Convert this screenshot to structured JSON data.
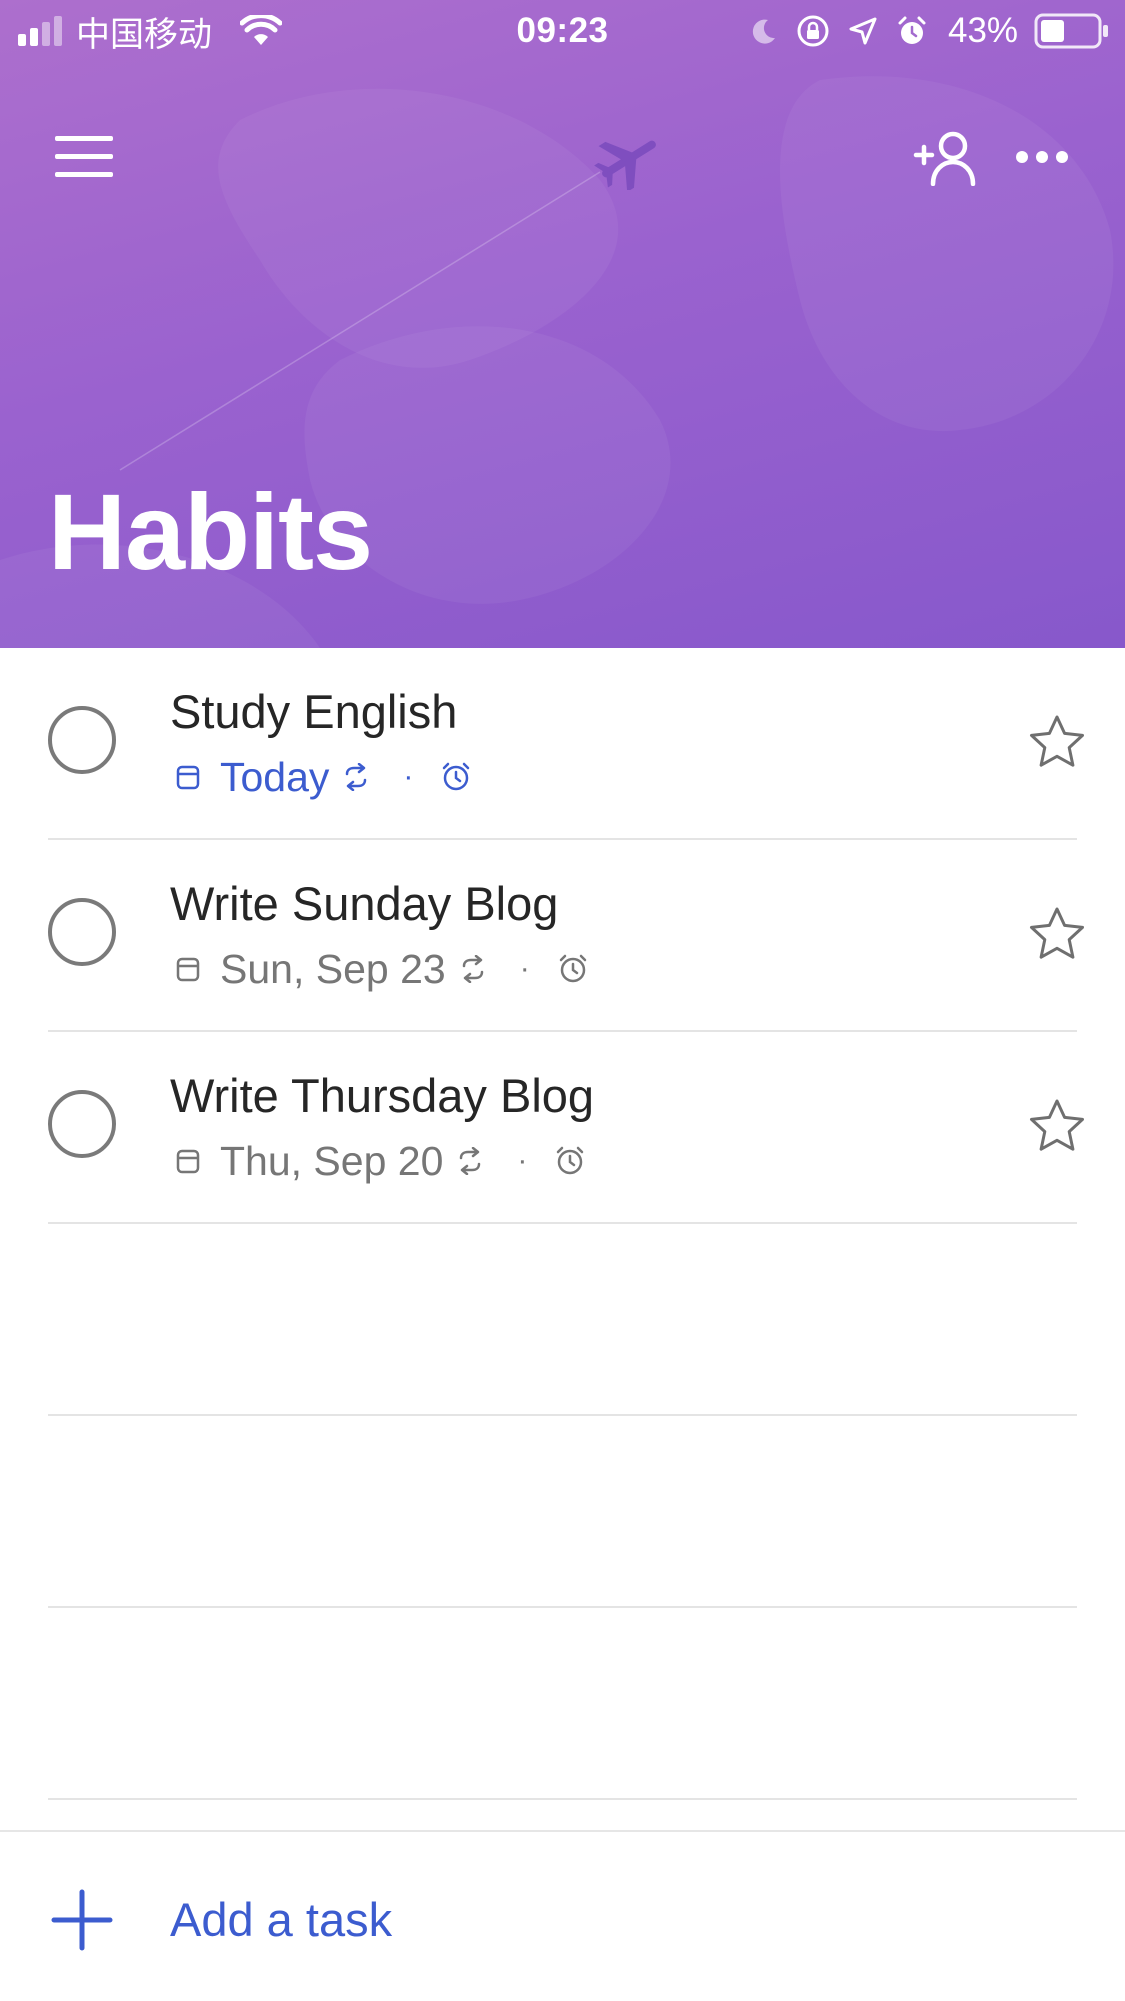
{
  "status_bar": {
    "carrier": "中国移动",
    "time": "09:23",
    "battery_percent": "43%",
    "battery_level": 0.43,
    "icons": [
      "signal-icon",
      "wifi-icon",
      "moon-icon",
      "orientation-lock-icon",
      "location-icon",
      "alarm-icon",
      "battery-icon"
    ]
  },
  "header": {
    "title": "Habits",
    "background_colors": [
      "#ad6fcd",
      "#8758cb"
    ],
    "icons": {
      "menu": "hamburger-menu-icon",
      "logo": "airplane-icon",
      "share": "add-person-icon",
      "more": "more-dots-icon"
    }
  },
  "tasks": [
    {
      "title": "Study English",
      "due_label": "Today",
      "is_today": true,
      "separator": "·",
      "icons": [
        "calendar-icon",
        "repeat-icon",
        "alarm-icon",
        "star-icon"
      ]
    },
    {
      "title": "Write Sunday Blog",
      "due_label": "Sun, Sep 23",
      "is_today": false,
      "separator": "·",
      "icons": [
        "calendar-icon",
        "repeat-icon",
        "alarm-icon",
        "star-icon"
      ]
    },
    {
      "title": "Write Thursday Blog",
      "due_label": "Thu, Sep 20",
      "is_today": false,
      "separator": "·",
      "icons": [
        "calendar-icon",
        "repeat-icon",
        "alarm-icon",
        "star-icon"
      ]
    }
  ],
  "add_task": {
    "label": "Add a task",
    "icon": "plus-icon"
  },
  "colors": {
    "accent_blue": "#3c5ccf",
    "meta_gray": "#767676",
    "title_text": "#262626",
    "divider": "#e4e4e4"
  }
}
